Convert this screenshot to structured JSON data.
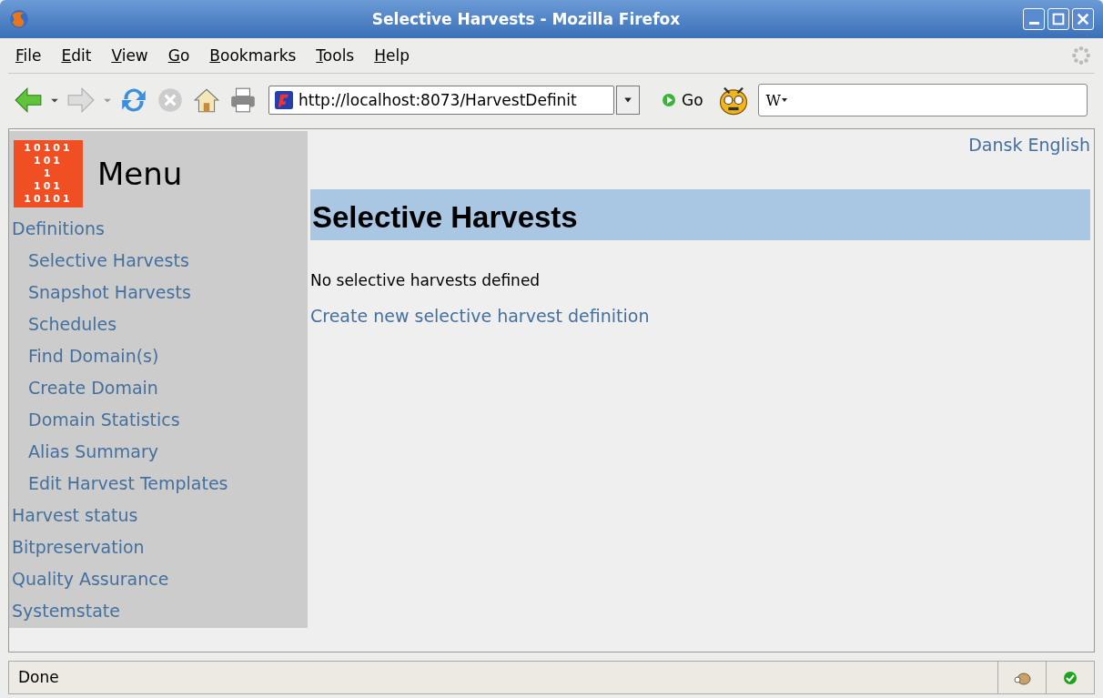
{
  "window": {
    "title": "Selective Harvests - Mozilla Firefox"
  },
  "menu_bar": [
    "File",
    "Edit",
    "View",
    "Go",
    "Bookmarks",
    "Tools",
    "Help"
  ],
  "toolbar": {
    "url": "http://localhost:8073/HarvestDefinit",
    "go_label": "Go",
    "search_value": "W"
  },
  "sidebar": {
    "logo_lines": [
      "10101",
      "101",
      "1",
      "101",
      "10101"
    ],
    "title": "Menu",
    "items": [
      {
        "label": "Definitions",
        "children": [
          {
            "label": "Selective Harvests"
          },
          {
            "label": "Snapshot Harvests"
          },
          {
            "label": "Schedules"
          },
          {
            "label": "Find Domain(s)"
          },
          {
            "label": "Create Domain"
          },
          {
            "label": "Domain Statistics"
          },
          {
            "label": "Alias Summary"
          },
          {
            "label": "Edit Harvest Templates"
          }
        ]
      },
      {
        "label": "Harvest status"
      },
      {
        "label": "Bitpreservation"
      },
      {
        "label": "Quality Assurance"
      },
      {
        "label": "Systemstate"
      }
    ]
  },
  "languages": [
    "Dansk",
    "English"
  ],
  "page": {
    "heading": "Selective Harvests",
    "message": "No selective harvests defined",
    "link": "Create new selective harvest definition"
  },
  "status_bar": {
    "text": "Done"
  }
}
